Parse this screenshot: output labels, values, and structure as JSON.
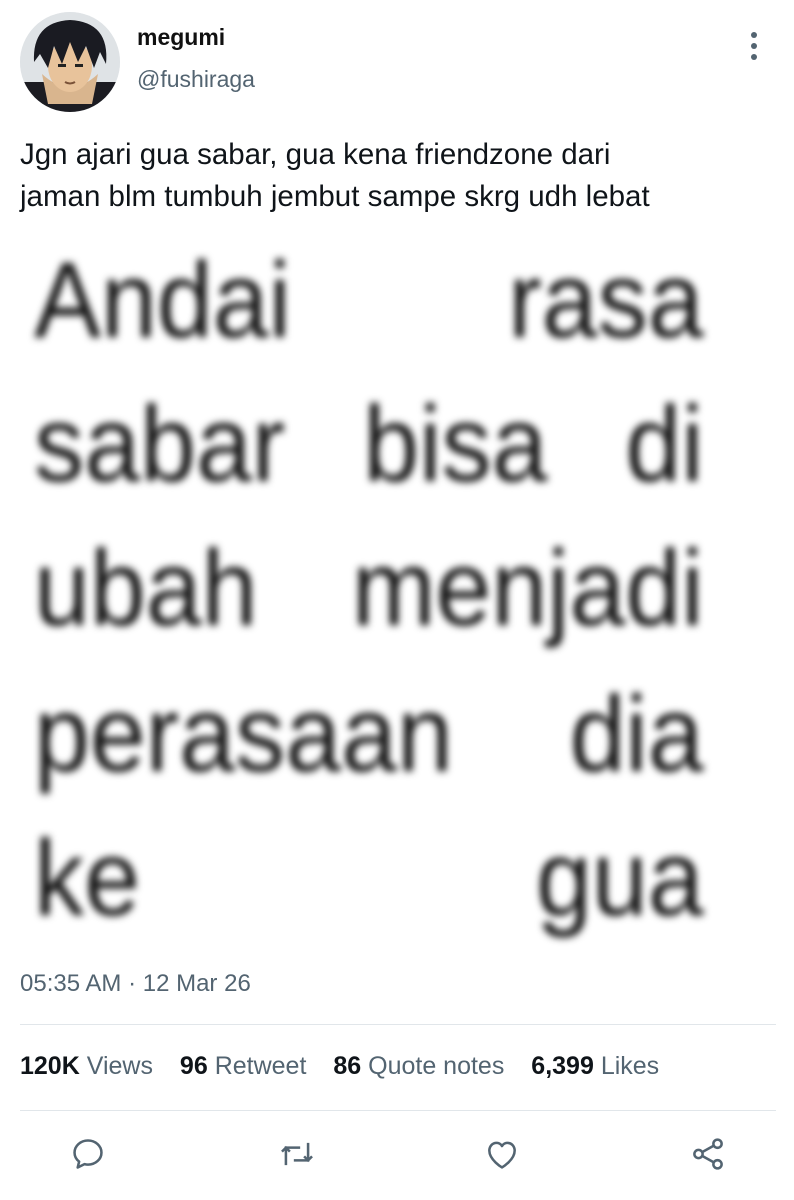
{
  "user": {
    "display_name": "megumi",
    "handle": "@fushiraga"
  },
  "tweet": {
    "text_lines": [
      "Jgn ajari gua sabar, gua kena friendzone dari",
      "jaman blm tumbuh jembut sampe skrg udh lebat"
    ],
    "image_text_lines": [
      [
        "Andai",
        "rasa"
      ],
      [
        "sabar",
        "bisa",
        "di"
      ],
      [
        "ubah",
        "menjadi"
      ],
      [
        "perasaan",
        "dia"
      ],
      [
        "ke",
        "gua"
      ]
    ],
    "timestamp": "05:35 AM · 12 Mar 26"
  },
  "stats": {
    "views_count": "120K",
    "views_label": "Views",
    "retweet_count": "96",
    "retweet_label": "Retweet",
    "quote_count": "86",
    "quote_label": "Quote notes",
    "likes_count": "6,399",
    "likes_label": "Likes"
  },
  "actions": [
    "reply-icon",
    "retweet-icon",
    "like-icon",
    "share-icon"
  ],
  "colors": {
    "secondary_text": "#536471",
    "primary_text": "#0f1419",
    "divider": "#e1e6ea"
  }
}
